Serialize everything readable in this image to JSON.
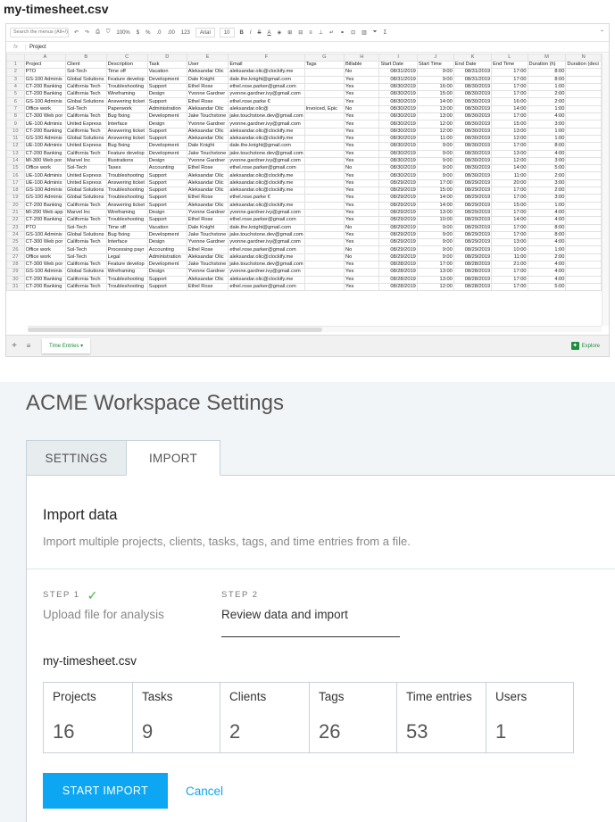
{
  "file_title": "my-timesheet.csv",
  "sheet": {
    "menu_search_placeholder": "Search the menus (Alt+/)",
    "toolbar": {
      "zoom": "100%",
      "currency": "$",
      "percent": "%",
      "dec_less": ".0",
      "dec_more": ".00",
      "format_more": "123",
      "font": "Arial",
      "font_size": "10",
      "bold": "B",
      "italic": "I",
      "strike": "S",
      "text_color": "A",
      "sigma": "Σ"
    },
    "fx": "fx",
    "formula_value": "Project",
    "col_letters": [
      "",
      "A",
      "B",
      "C",
      "D",
      "E",
      "F",
      "G",
      "H",
      "I",
      "J",
      "K",
      "L",
      "M",
      "N"
    ],
    "rows": [
      [
        "1",
        "Project",
        "Client",
        "Description",
        "Task",
        "User",
        "Email",
        "Tags",
        "Billable",
        "Start Date",
        "Start Time",
        "End Date",
        "End Time",
        "Duration (h)",
        "Duration (deci"
      ],
      [
        "2",
        "PTO",
        "Sol-Tech",
        "Time off",
        "Vacation",
        "Aleksandar Olic",
        "aleksandar.olic@clockify.me",
        "",
        "No",
        "08/31/2019",
        "9:00",
        "08/31/2019",
        "17:00",
        "8:00",
        ""
      ],
      [
        "3",
        "GS-100 Adminis",
        "Global Solutions",
        "Feature develop",
        "Development",
        "Dale Knight",
        "dale.the.knight@gmail.com",
        "",
        "Yes",
        "08/31/2019",
        "9:00",
        "08/31/2019",
        "17:00",
        "8:00",
        ""
      ],
      [
        "4",
        "CT-200 Banking",
        "California Tech",
        "Troubleshooting",
        "Support",
        "Ethel Rose",
        "ethel.rose.parker@gmail.com",
        "",
        "Yes",
        "08/30/2019",
        "16:00",
        "08/30/2019",
        "17:00",
        "1:00",
        ""
      ],
      [
        "5",
        "CT-200 Banking",
        "California Tech",
        "Wireframing",
        "Design",
        "Yvonne Gardner",
        "yvonne.gardner.ivy@gmail.com",
        "",
        "Yes",
        "08/30/2019",
        "15:00",
        "08/30/2019",
        "17:00",
        "2:00",
        ""
      ],
      [
        "6",
        "GS-100 Adminis",
        "Global Solutions",
        "Answering ticket",
        "Support",
        "Ethel Rose",
        "ethel.rose.parke €",
        "",
        "Yes",
        "08/30/2019",
        "14:00",
        "08/30/2019",
        "16:00",
        "2:00",
        ""
      ],
      [
        "7",
        "Office work",
        "Sol-Tech",
        "Paperwork",
        "Administration",
        "Aleksandar Olic",
        "aleksandar.olic@",
        "Invoiced, Epic",
        "No",
        "08/30/2019",
        "13:00",
        "08/30/2019",
        "14:00",
        "1:00",
        ""
      ],
      [
        "8",
        "CT-300 Web por",
        "California Tech",
        "Bug fixing",
        "Development",
        "Jake Touchstone",
        "jake.touchstone.dev@gmail.com",
        "",
        "Yes",
        "08/30/2019",
        "13:00",
        "08/30/2019",
        "17:00",
        "4:00",
        ""
      ],
      [
        "9",
        "UE-100 Adminis",
        "United Express",
        "Interface",
        "Design",
        "Yvonne Gardner",
        "yvonne.gardner.ivy@gmail.com",
        "",
        "Yes",
        "08/30/2019",
        "12:00",
        "08/30/2019",
        "15:00",
        "3:00",
        ""
      ],
      [
        "10",
        "CT-200 Banking",
        "California Tech",
        "Answering ticket",
        "Support",
        "Aleksandar Olic",
        "aleksandar.olic@clockify.me",
        "",
        "Yes",
        "08/30/2019",
        "12:00",
        "08/30/2019",
        "13:00",
        "1:00",
        ""
      ],
      [
        "11",
        "GS-100 Adminis",
        "Global Solutions",
        "Answering ticket",
        "Support",
        "Aleksandar Olic",
        "aleksandar.olic@clockify.me",
        "",
        "Yes",
        "08/30/2019",
        "11:00",
        "08/30/2019",
        "12:00",
        "1:00",
        ""
      ],
      [
        "12",
        "UE-100 Adminis",
        "United Express",
        "Bug fixing",
        "Development",
        "Dale Knight",
        "dale.the.knight@gmail.com",
        "",
        "Yes",
        "08/30/2019",
        "9:00",
        "08/30/2019",
        "17:00",
        "8:00",
        ""
      ],
      [
        "13",
        "CT-200 Banking",
        "California Tech",
        "Feature develop",
        "Development",
        "Jake Touchstone",
        "jake.touchstone.dev@gmail.com",
        "",
        "Yes",
        "08/30/2019",
        "9:00",
        "08/30/2019",
        "13:00",
        "4:00",
        ""
      ],
      [
        "14",
        "MI-300 Web por",
        "Marvel Inc",
        "Illustrations",
        "Design",
        "Yvonne Gardner",
        "yvonne.gardner.ivy@gmail.com",
        "",
        "Yes",
        "08/30/2019",
        "9:00",
        "08/30/2019",
        "12:00",
        "3:00",
        ""
      ],
      [
        "15",
        "Office work",
        "Sol-Tech",
        "Taxes",
        "Accounting",
        "Ethel Rose",
        "ethel.rose.parker@gmail.com",
        "",
        "No",
        "08/30/2019",
        "9:00",
        "08/30/2019",
        "14:00",
        "5:00",
        ""
      ],
      [
        "16",
        "UE-100 Adminis",
        "United Express",
        "Troubleshooting",
        "Support",
        "Aleksandar Olic",
        "aleksandar.olic@clockify.me",
        "",
        "Yes",
        "08/30/2019",
        "9:00",
        "08/30/2019",
        "11:00",
        "2:00",
        ""
      ],
      [
        "17",
        "UE-100 Adminis",
        "United Express",
        "Answering ticket",
        "Support",
        "Aleksandar Olic",
        "aleksandar.olic@clockify.me",
        "",
        "Yes",
        "08/29/2019",
        "17:00",
        "08/29/2019",
        "20:00",
        "3:00",
        ""
      ],
      [
        "18",
        "GS-100 Adminis",
        "Global Solutions",
        "Troubleshooting",
        "Support",
        "Aleksandar Olic",
        "aleksandar.olic@clockify.me",
        "",
        "Yes",
        "08/29/2019",
        "15:00",
        "08/29/2019",
        "17:00",
        "2:00",
        ""
      ],
      [
        "19",
        "GS-100 Adminis",
        "Global Solutions",
        "Troubleshooting",
        "Support",
        "Ethel Rose",
        "ethel.rose.parke €",
        "",
        "Yes",
        "08/29/2019",
        "14:00",
        "08/29/2019",
        "17:00",
        "3:00",
        ""
      ],
      [
        "20",
        "CT-200 Banking",
        "California Tech",
        "Answering ticket",
        "Support",
        "Aleksandar Olic",
        "aleksandar.olic@clockify.me",
        "",
        "Yes",
        "08/29/2019",
        "14:00",
        "08/29/2019",
        "15:00",
        "1:00",
        ""
      ],
      [
        "21",
        "MI-200 Web app",
        "Marvel Inc",
        "Wireframing",
        "Design",
        "Yvonne Gardner",
        "yvonne.gardner.ivy@gmail.com",
        "",
        "Yes",
        "08/29/2019",
        "13:00",
        "08/29/2019",
        "17:00",
        "4:00",
        ""
      ],
      [
        "22",
        "CT-200 Banking",
        "California Tech",
        "Troubleshooting",
        "Support",
        "Ethel Rose",
        "ethel.rose.parker@gmail.com",
        "",
        "Yes",
        "08/29/2019",
        "10:00",
        "08/29/2019",
        "14:00",
        "4:00",
        ""
      ],
      [
        "23",
        "PTO",
        "Sol-Tech",
        "Time off",
        "Vacation",
        "Dale Knight",
        "dale.the.knight@gmail.com",
        "",
        "No",
        "08/29/2019",
        "9:00",
        "08/29/2019",
        "17:00",
        "8:00",
        ""
      ],
      [
        "24",
        "GS-100 Adminis",
        "Global Solutions",
        "Bug fixing",
        "Development",
        "Jake Touchstone",
        "jake.touchstone.dev@gmail.com",
        "",
        "Yes",
        "08/29/2019",
        "9:00",
        "08/29/2019",
        "17:00",
        "8:00",
        ""
      ],
      [
        "25",
        "CT-300 Web por",
        "California Tech",
        "Interface",
        "Design",
        "Yvonne Gardner",
        "yvonne.gardner.ivy@gmail.com",
        "",
        "Yes",
        "08/29/2019",
        "9:00",
        "08/29/2019",
        "13:00",
        "4:00",
        ""
      ],
      [
        "26",
        "Office work",
        "Sol-Tech",
        "Processing payr",
        "Accounting",
        "Ethel Rose",
        "ethel.rose.parker@gmail.com",
        "",
        "No",
        "08/29/2019",
        "9:00",
        "08/29/2019",
        "10:00",
        "1:00",
        ""
      ],
      [
        "27",
        "Office work",
        "Sol-Tech",
        "Legal",
        "Administration",
        "Aleksandar Olic",
        "aleksandar.olic@clockify.me",
        "",
        "No",
        "08/29/2019",
        "9:00",
        "08/29/2019",
        "11:00",
        "2:00",
        ""
      ],
      [
        "28",
        "CT-300 Web por",
        "California Tech",
        "Feature develop",
        "Development",
        "Jake Touchstone",
        "jake.touchstone.dev@gmail.com",
        "",
        "Yes",
        "08/28/2019",
        "17:00",
        "08/28/2019",
        "21:00",
        "4:00",
        ""
      ],
      [
        "29",
        "GS-100 Adminis",
        "Global Solutions",
        "Wireframing",
        "Design",
        "Yvonne Gardner",
        "yvonne.gardner.ivy@gmail.com",
        "",
        "Yes",
        "08/28/2019",
        "13:00",
        "08/28/2019",
        "17:00",
        "4:00",
        ""
      ],
      [
        "30",
        "CT-200 Banking",
        "California Tech",
        "Troubleshooting",
        "Support",
        "Aleksandar Olic",
        "aleksandar.olic@clockify.me",
        "",
        "Yes",
        "08/28/2019",
        "13:00",
        "08/28/2019",
        "17:00",
        "4:00",
        ""
      ],
      [
        "31",
        "CT-200 Banking",
        "California Tech",
        "Troubleshooting",
        "Support",
        "Ethel Rose",
        "ethel.rose.parker@gmail.com",
        "",
        "Yes",
        "08/28/2019",
        "12:00",
        "08/28/2019",
        "17:00",
        "5:00",
        ""
      ]
    ],
    "sheet_tab": "Time Entries",
    "explore": "Explore"
  },
  "settings": {
    "title": "ACME Workspace Settings",
    "tabs": [
      "SETTINGS",
      "IMPORT"
    ],
    "import_heading": "Import data",
    "import_desc": "Import multiple projects, clients, tasks, tags, and time entries from a file.",
    "step1_tag": "STEP 1",
    "step1_label": "Upload file for analysis",
    "step2_tag": "STEP 2",
    "step2_label": "Review data and import",
    "file_name": "my-timesheet.csv",
    "stats": [
      {
        "label": "Projects",
        "value": "16"
      },
      {
        "label": "Tasks",
        "value": "9"
      },
      {
        "label": "Clients",
        "value": "2"
      },
      {
        "label": "Tags",
        "value": "26"
      },
      {
        "label": "Time entries",
        "value": "53"
      },
      {
        "label": "Users",
        "value": "1"
      }
    ],
    "start_button": "START IMPORT",
    "cancel": "Cancel",
    "accent_color": "#0ca6f2"
  }
}
